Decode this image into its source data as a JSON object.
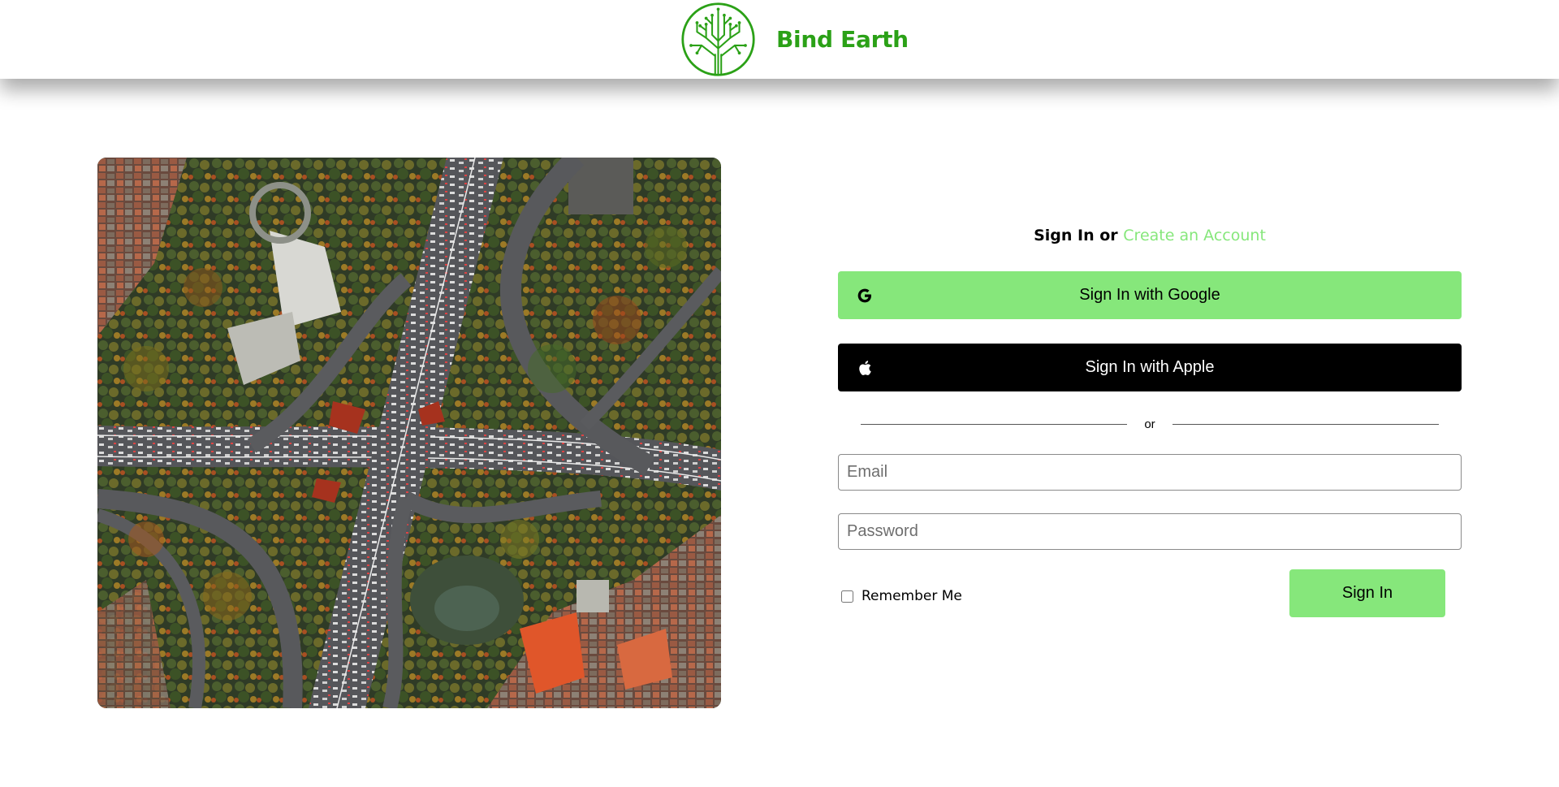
{
  "brand": {
    "name": "Bind Earth",
    "logo_icon": "tree-circuit-icon",
    "color": "#2ba117"
  },
  "hero": {
    "image_icon": "aerial-highway-interchange-photo"
  },
  "signin": {
    "heading_signin": "Sign In",
    "heading_or": " or ",
    "create_account": "Create an Account",
    "google_label": "Sign In with Google",
    "google_icon": "google-icon",
    "apple_label": "Sign In with Apple",
    "apple_icon": "apple-icon",
    "divider_text": "or",
    "email_placeholder": "Email",
    "email_value": "",
    "password_placeholder": "Password",
    "password_value": "",
    "remember_label": "Remember Me",
    "remember_checked": false,
    "submit_label": "Sign In"
  },
  "colors": {
    "accent": "#86e77b",
    "brand": "#2ba117",
    "apple_button": "#000000"
  }
}
